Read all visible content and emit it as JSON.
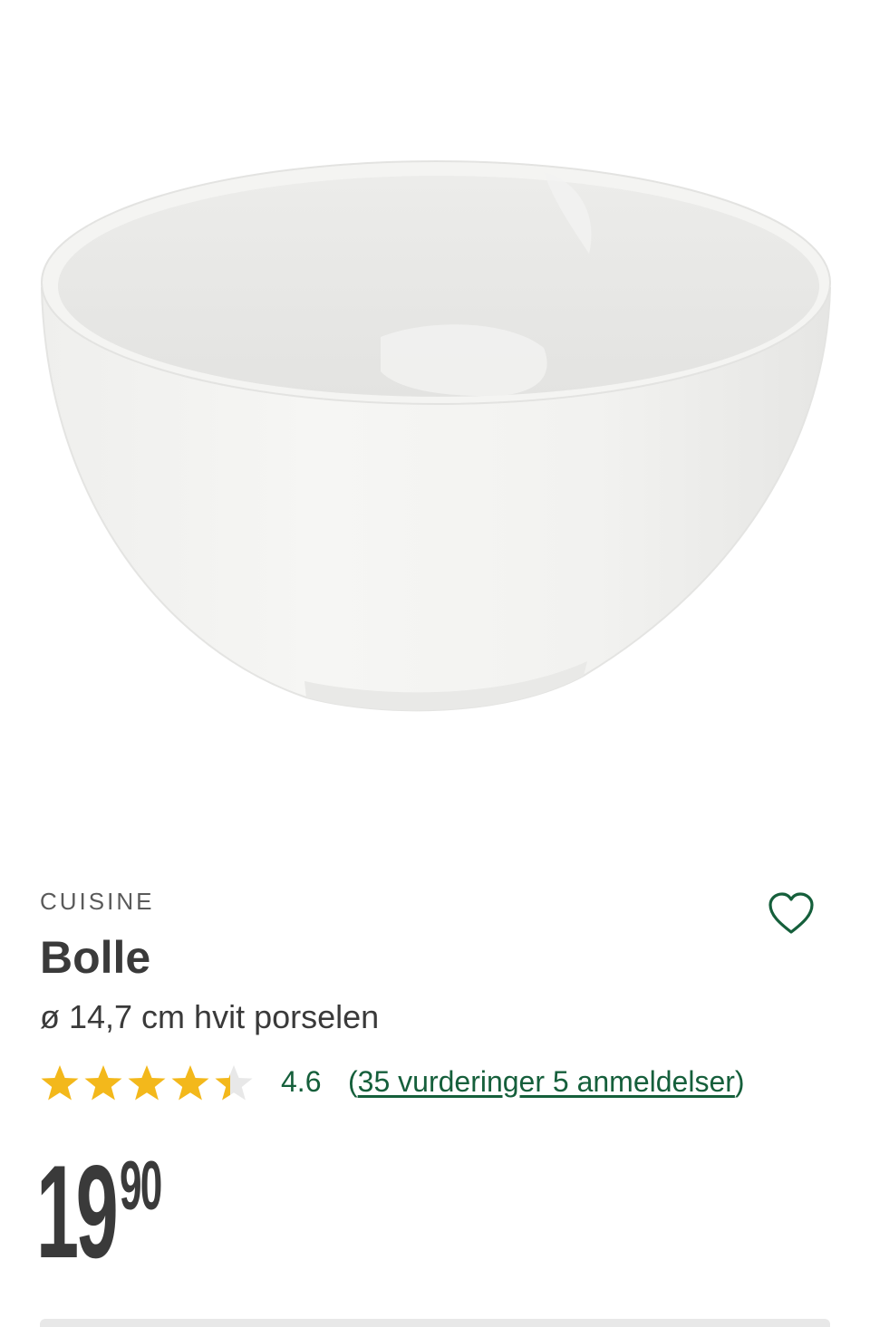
{
  "product": {
    "brand": "CUISINE",
    "title": "Bolle",
    "subtitle": "ø 14,7 cm hvit porselen",
    "image_name": "white-porcelain-bowl",
    "favorite_icon": "heart-outline-icon"
  },
  "rating": {
    "value": "4.6",
    "stars_filled_fraction": 0.92,
    "open_paren": "(",
    "link_text": "35 vurderinger 5 anmeldelser",
    "close_paren": ")"
  },
  "price": {
    "main": "19",
    "cents": "90"
  },
  "colors": {
    "accent_green": "#155f3b",
    "star_gold": "#f3b81b",
    "text_dark": "#3a3a3a"
  }
}
